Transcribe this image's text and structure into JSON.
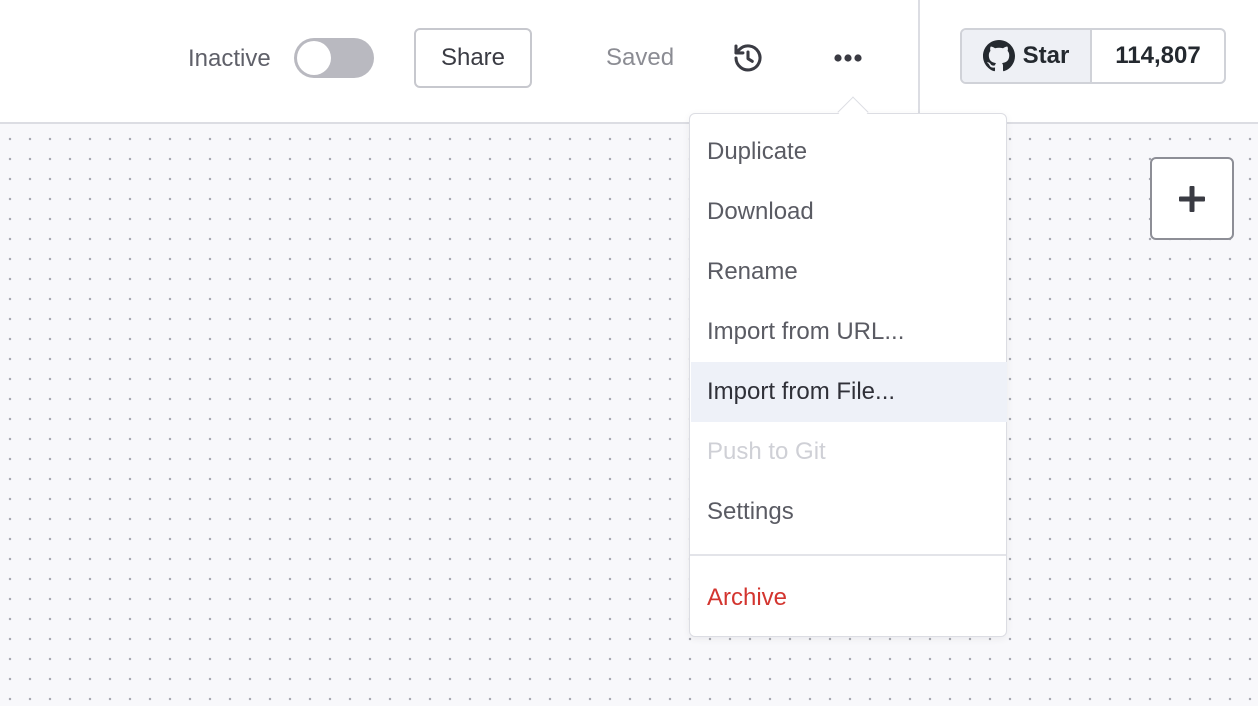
{
  "header": {
    "status_label": "Inactive",
    "active": false,
    "share_label": "Share",
    "save_status": "Saved",
    "history_icon": "history-icon",
    "more_icon": "more-horizontal-icon"
  },
  "github": {
    "icon": "github-icon",
    "star_label": "Star",
    "star_count": "114,807"
  },
  "menu": {
    "items": [
      {
        "label": "Duplicate",
        "state": "normal"
      },
      {
        "label": "Download",
        "state": "normal"
      },
      {
        "label": "Rename",
        "state": "normal"
      },
      {
        "label": "Import from URL...",
        "state": "normal"
      },
      {
        "label": "Import from File...",
        "state": "hovered"
      },
      {
        "label": "Push to Git",
        "state": "disabled"
      },
      {
        "label": "Settings",
        "state": "normal"
      },
      {
        "label": "Archive",
        "state": "danger"
      }
    ]
  },
  "canvas": {
    "add_icon": "plus-icon"
  },
  "colors": {
    "accent_danger": "#d3352f",
    "hover_bg": "#eef1f8",
    "toggle_off": "#b9b9c0",
    "canvas_bg": "#f8f8fb"
  }
}
